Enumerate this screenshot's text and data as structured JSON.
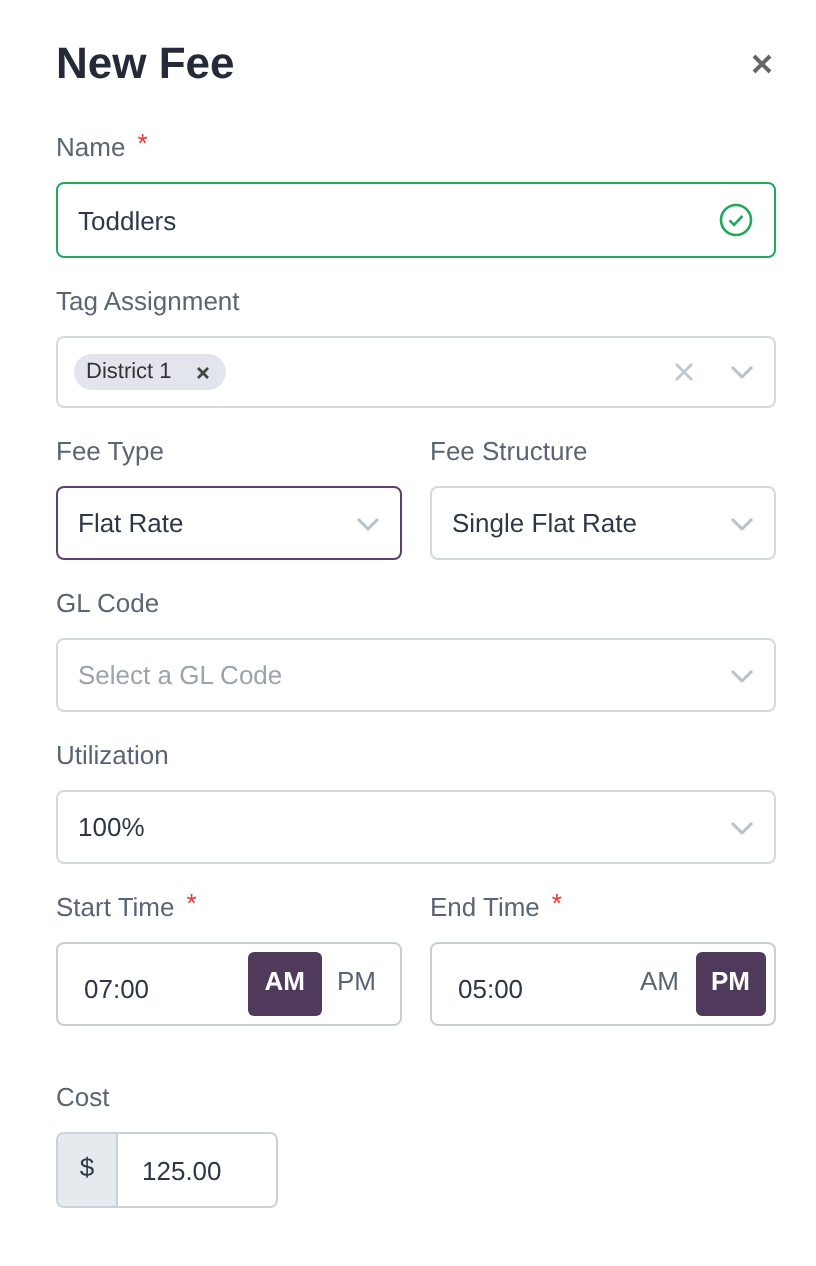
{
  "title": "New Fee",
  "name": {
    "label": "Name",
    "required_mark": "*",
    "value": "Toddlers",
    "valid": true
  },
  "tag_assignment": {
    "label": "Tag Assignment",
    "tags": [
      {
        "label": "District 1"
      }
    ]
  },
  "fee_type": {
    "label": "Fee Type",
    "value": "Flat Rate",
    "focused": true
  },
  "fee_structure": {
    "label": "Fee Structure",
    "value": "Single Flat Rate",
    "focused": false
  },
  "gl_code": {
    "label": "GL Code",
    "placeholder": "Select a GL Code"
  },
  "utilization": {
    "label": "Utilization",
    "value": "100%"
  },
  "start_time": {
    "label": "Start Time",
    "required_mark": "*",
    "value": "07:00",
    "periods": [
      {
        "label": "AM",
        "selected": true
      },
      {
        "label": "PM",
        "selected": false
      }
    ]
  },
  "end_time": {
    "label": "End Time",
    "required_mark": "*",
    "value": "05:00",
    "periods": [
      {
        "label": "AM",
        "selected": false
      },
      {
        "label": "PM",
        "selected": true
      }
    ]
  },
  "cost": {
    "label": "Cost",
    "prefix": "$",
    "value": "125.00"
  }
}
